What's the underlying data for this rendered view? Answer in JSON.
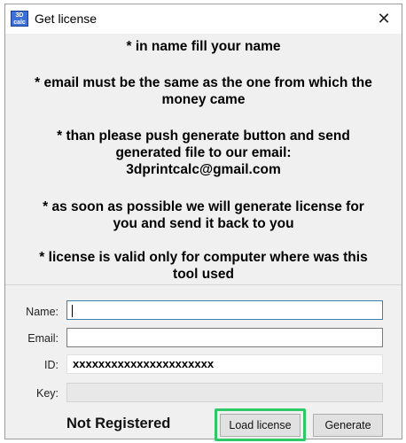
{
  "window": {
    "title": "Get license",
    "icon": "3d-print-calc-app-icon",
    "icon_text_top": "3D",
    "icon_text_bottom": "calc",
    "close_glyph": "✕"
  },
  "info": {
    "lines": [
      "* in name fill your name",
      "* email must be the same as the one from which the",
      "money came",
      "* than please push generate button and send",
      "generated file to our email:",
      "3dprintcalc@gmail.com",
      "* as soon as possible we will generate license for",
      "you and send it back to you",
      "* license is valid only for computer where was this",
      "tool used"
    ]
  },
  "form": {
    "name_label": "Name:",
    "name_value": "",
    "email_label": "Email:",
    "email_value": "",
    "id_label": "ID:",
    "id_value": "xxxxxxxxxxxxxxxxxxxxxx",
    "key_label": "Key:",
    "key_value": ""
  },
  "footer": {
    "status": "Not Registered",
    "load_label": "Load license",
    "generate_label": "Generate"
  },
  "colors": {
    "highlight": "#2ec866",
    "focus_border": "#3c7fb1"
  }
}
